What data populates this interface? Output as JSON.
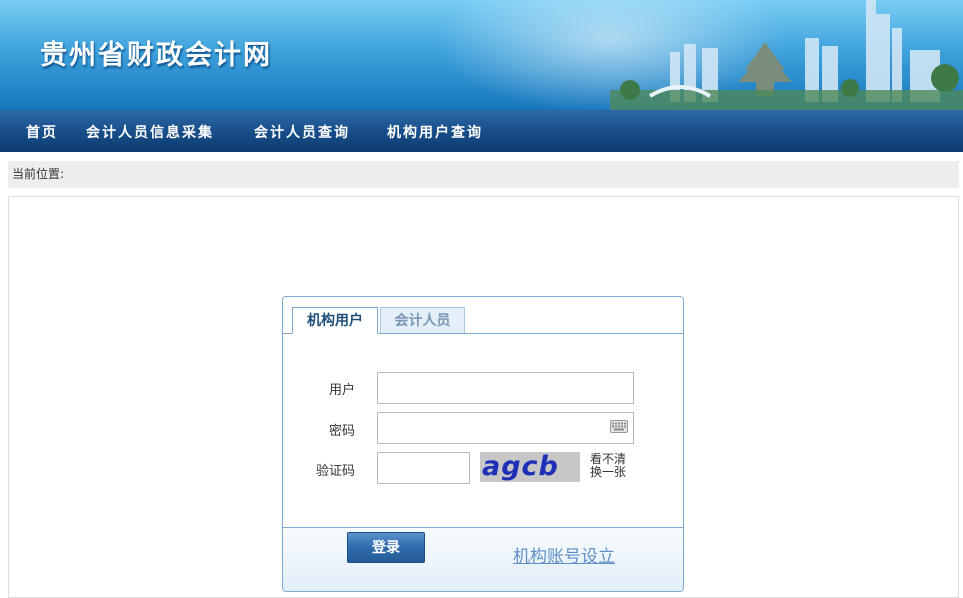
{
  "header": {
    "site_title": "贵州省财政会计网"
  },
  "nav": {
    "items": [
      {
        "label": "首页"
      },
      {
        "label": "会计人员信息采集"
      },
      {
        "label": "会计人员查询"
      },
      {
        "label": "机构用户查询"
      }
    ]
  },
  "breadcrumb": {
    "label": "当前位置:"
  },
  "login": {
    "tabs": [
      {
        "label": "机构用户",
        "active": true
      },
      {
        "label": "会计人员",
        "active": false
      }
    ],
    "user_label": "用户",
    "user_value": "",
    "password_label": "密码",
    "password_value": "",
    "keyboard_icon": "keyboard-icon",
    "captcha_label": "验证码",
    "captcha_value": "",
    "captcha_text": "agcb",
    "refresh_label_line1": "看不清",
    "refresh_label_line2": "换一张",
    "submit_label": "登录",
    "setup_link": "机构账号设立"
  },
  "colors": {
    "banner_top": "#79cdf4",
    "banner_bottom": "#1676bd",
    "nav_bg": "#174d88",
    "panel_border": "#7fa9cf",
    "captcha_bg": "#c7c7c7",
    "captcha_text": "#1f2fb8",
    "link": "#5f8fc5"
  }
}
